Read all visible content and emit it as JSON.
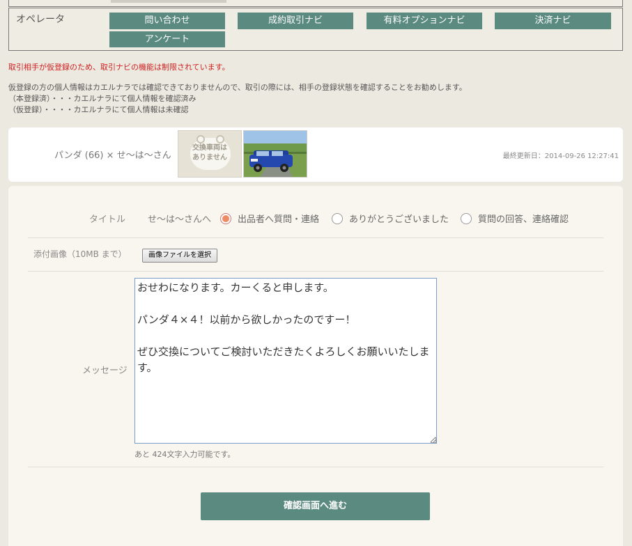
{
  "operator": {
    "label": "オペレータ",
    "buttons": [
      "問い合わせ",
      "成約取引ナビ",
      "有料オプションナビ",
      "決済ナビ",
      "アンケート"
    ]
  },
  "notice_red": "取引相手が仮登録のため、取引ナビの機能は制限されています。",
  "notice_lines": [
    "仮登録の方の個人情報はカエルナラでは確認できておりませんので、取引の際には、相手の登録状態を確認することをお勧めします。",
    "（本登録済）・・・カエルナラにて個人情報を確認済み",
    "（仮登録）・・・・カエルナラにて個人情報は未確認"
  ],
  "trade": {
    "title": "パンダ (66) × せ〜は〜さん",
    "no_image_text": "交換車両は\nありません",
    "last_updated": "最終更新日：2014-09-26 12:27:41"
  },
  "form": {
    "title_label": "タイトル",
    "title_to": "せ〜は〜さんへ",
    "radio_options": [
      {
        "label": "出品者へ質問・連絡",
        "checked": true
      },
      {
        "label": "ありがとうございました",
        "checked": false
      },
      {
        "label": "質問の回答、連絡確認",
        "checked": false
      }
    ],
    "attach_label": "添付画像（10MB まで）",
    "file_button": "画像ファイルを選択",
    "message_label": "メッセージ",
    "message_value": "おせわになります。カーくると申します。\n\nパンダ４×４！以前から欲しかったのですー！\n\nぜひ交換についてご検討いただきたくよろしくお願いいたします。",
    "counter": "あと 424文字入力可能です。",
    "submit": "確認画面へ進む"
  },
  "colors": {
    "accent": "#5b8a80",
    "warning": "#d02020",
    "radio_checked": "#ee8a64"
  }
}
